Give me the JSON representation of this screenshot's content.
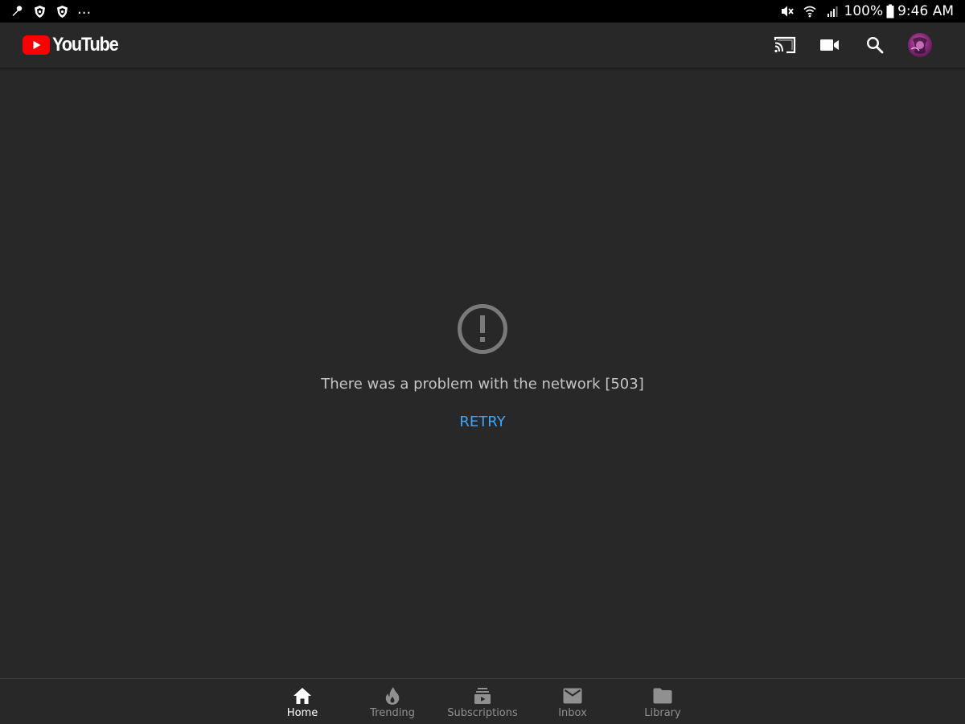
{
  "status_bar": {
    "left_icons": [
      "microphone-icon",
      "shield-icon",
      "shield-icon"
    ],
    "more": "...",
    "right_icons": [
      "mute-icon",
      "wifi-icon",
      "signal-icon"
    ],
    "battery": "100%",
    "time": "9:46 AM"
  },
  "app_bar": {
    "logo_text": "YouTube",
    "actions": [
      "cast-icon",
      "camera-icon",
      "search-icon",
      "avatar"
    ]
  },
  "error": {
    "message": "There was a problem with the network [503]",
    "retry_label": "RETRY"
  },
  "bottom_nav": {
    "items": [
      {
        "label": "Home",
        "icon": "home-icon",
        "active": true
      },
      {
        "label": "Trending",
        "icon": "trending-icon",
        "active": false
      },
      {
        "label": "Subscriptions",
        "icon": "subscriptions-icon",
        "active": false
      },
      {
        "label": "Inbox",
        "icon": "inbox-icon",
        "active": false
      },
      {
        "label": "Library",
        "icon": "library-icon",
        "active": false
      }
    ]
  },
  "colors": {
    "background": "#282828",
    "status_bar": "#000000",
    "accent_red": "#ff0000",
    "retry_blue": "#3ea6ff",
    "message_gray": "#c5c5c5",
    "nav_inactive": "#909090"
  }
}
